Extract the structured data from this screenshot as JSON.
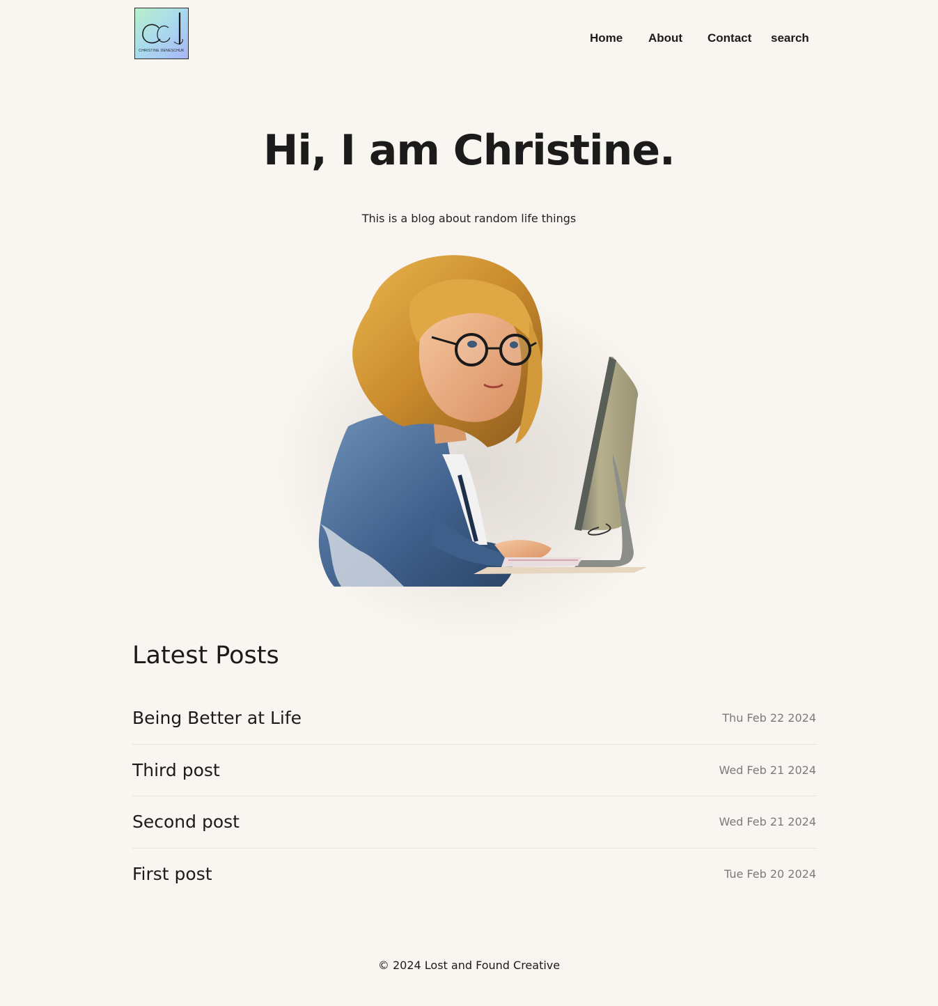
{
  "header": {
    "logo_monogram": "cd",
    "logo_text": "CHRISTINE DENESCHUK",
    "nav": {
      "home": "Home",
      "about": "About",
      "contact": "Contact",
      "search": "search"
    }
  },
  "hero": {
    "title": "Hi, I am Christine.",
    "subtitle": "This is a blog about random life things",
    "illustration": "woman-with-glasses-at-computer-illustration"
  },
  "latest_posts": {
    "heading": "Latest Posts",
    "items": [
      {
        "title": "Being Better at Life",
        "date": "Thu Feb 22 2024"
      },
      {
        "title": "Third post",
        "date": "Wed Feb 21 2024"
      },
      {
        "title": "Second post",
        "date": "Wed Feb 21 2024"
      },
      {
        "title": "First post",
        "date": "Tue Feb 20 2024"
      }
    ]
  },
  "footer": {
    "copyright": "© 2024 Lost and Found Creative"
  },
  "colors": {
    "background": "#f9f5f0",
    "text": "#1b1b1b",
    "muted_text": "#7b7b7b",
    "divider": "#e4e0da"
  }
}
